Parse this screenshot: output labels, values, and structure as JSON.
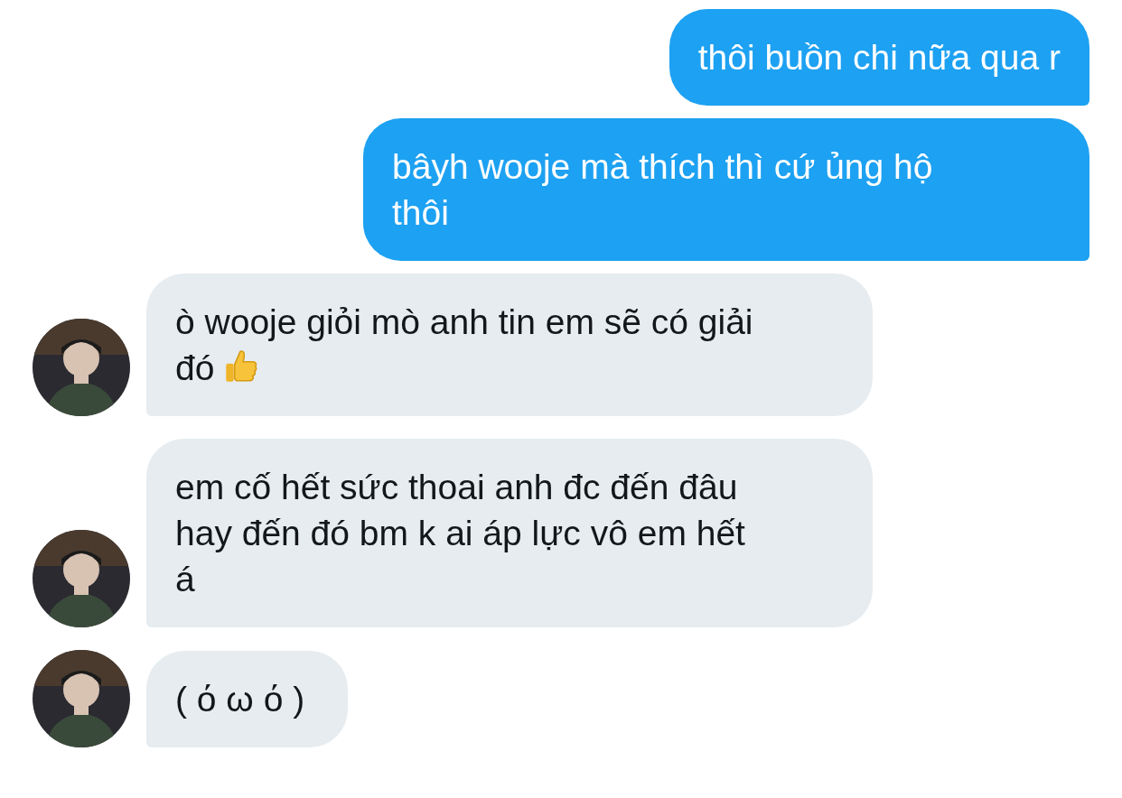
{
  "messages": [
    {
      "kind": "outgoing",
      "lines": [
        "thôi buồn chi nữa qua r"
      ]
    },
    {
      "kind": "outgoing",
      "lines": [
        "bâyh wooje mà thích thì cứ ủng hộ",
        "thôi"
      ]
    },
    {
      "kind": "incoming",
      "lines": [
        "ò wooje giỏi mò anh tin em sẽ có giải",
        "đó"
      ],
      "thumbs_up": true,
      "avatar": {
        "kind": "picture"
      }
    },
    {
      "kind": "incoming",
      "lines": [
        "em cố hết sức thoai anh đc đến đâu",
        "hay đến đó bm k ai áp lực vô em hết",
        "á"
      ],
      "avatar": {
        "kind": "picture"
      }
    },
    {
      "kind": "incoming",
      "lines": [
        "( ό ω ό )"
      ],
      "avatar": {
        "kind": "picture"
      }
    }
  ]
}
